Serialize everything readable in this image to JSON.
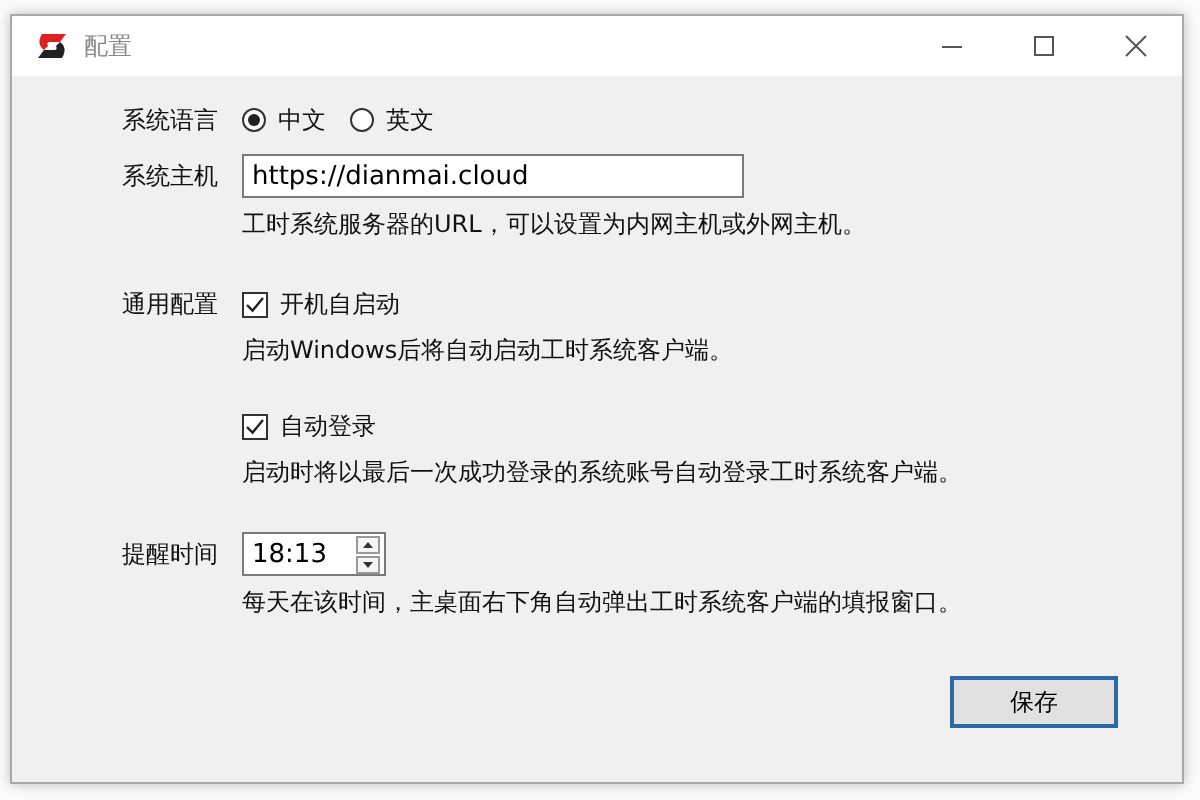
{
  "window": {
    "title": "配置"
  },
  "language": {
    "label": "系统语言",
    "options": [
      {
        "label": "中文",
        "selected": true
      },
      {
        "label": "英文",
        "selected": false
      }
    ]
  },
  "host": {
    "label": "系统主机",
    "value": "https://dianmai.cloud",
    "hint": "工时系统服务器的URL，可以设置为内网主机或外网主机。"
  },
  "general": {
    "label": "通用配置",
    "options": [
      {
        "label": "开机自启动",
        "checked": true,
        "hint": "启动Windows后将自动启动工时系统客户端。"
      },
      {
        "label": "自动登录",
        "checked": true,
        "hint": "启动时将以最后一次成功登录的系统账号自动登录工时系统客户端。"
      }
    ]
  },
  "reminder": {
    "label": "提醒时间",
    "value": "18:13",
    "hint": "每天在该时间，主桌面右下角自动弹出工时系统客户端的填报窗口。"
  },
  "buttons": [
    "保存"
  ]
}
